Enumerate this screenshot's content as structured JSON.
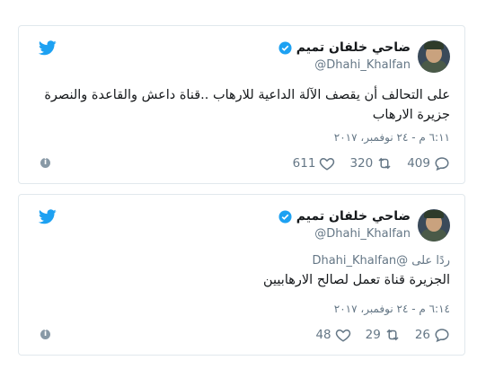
{
  "colors": {
    "brand": "#1da1f2",
    "text": "#14171a",
    "muted": "#657786",
    "border": "#e1e8ed"
  },
  "tweets": [
    {
      "name": "ضاحي خلفان تميم",
      "handle": "@Dhahi_Khalfan",
      "text": "على التحالف أن يقصف الآلة الداعية للارهاب ..قناة داعش والقاعدة والنصرة جزيرة الارهاب",
      "time": "٦:١١ م - ٢٤ نوفمبر، ٢٠١٧",
      "replies": "409",
      "retweets": "320",
      "likes": "611",
      "info": "i"
    },
    {
      "name": "ضاحي خلفان تميم",
      "handle": "@Dhahi_Khalfan",
      "reply_to": "ردًا على @Dhahi_Khalfan",
      "text": "الجزيرة قناة تعمل لصالح الارهابيين",
      "time": "٦:١٤ م - ٢٤ نوفمبر، ٢٠١٧",
      "replies": "26",
      "retweets": "29",
      "likes": "48",
      "info": "i"
    }
  ]
}
